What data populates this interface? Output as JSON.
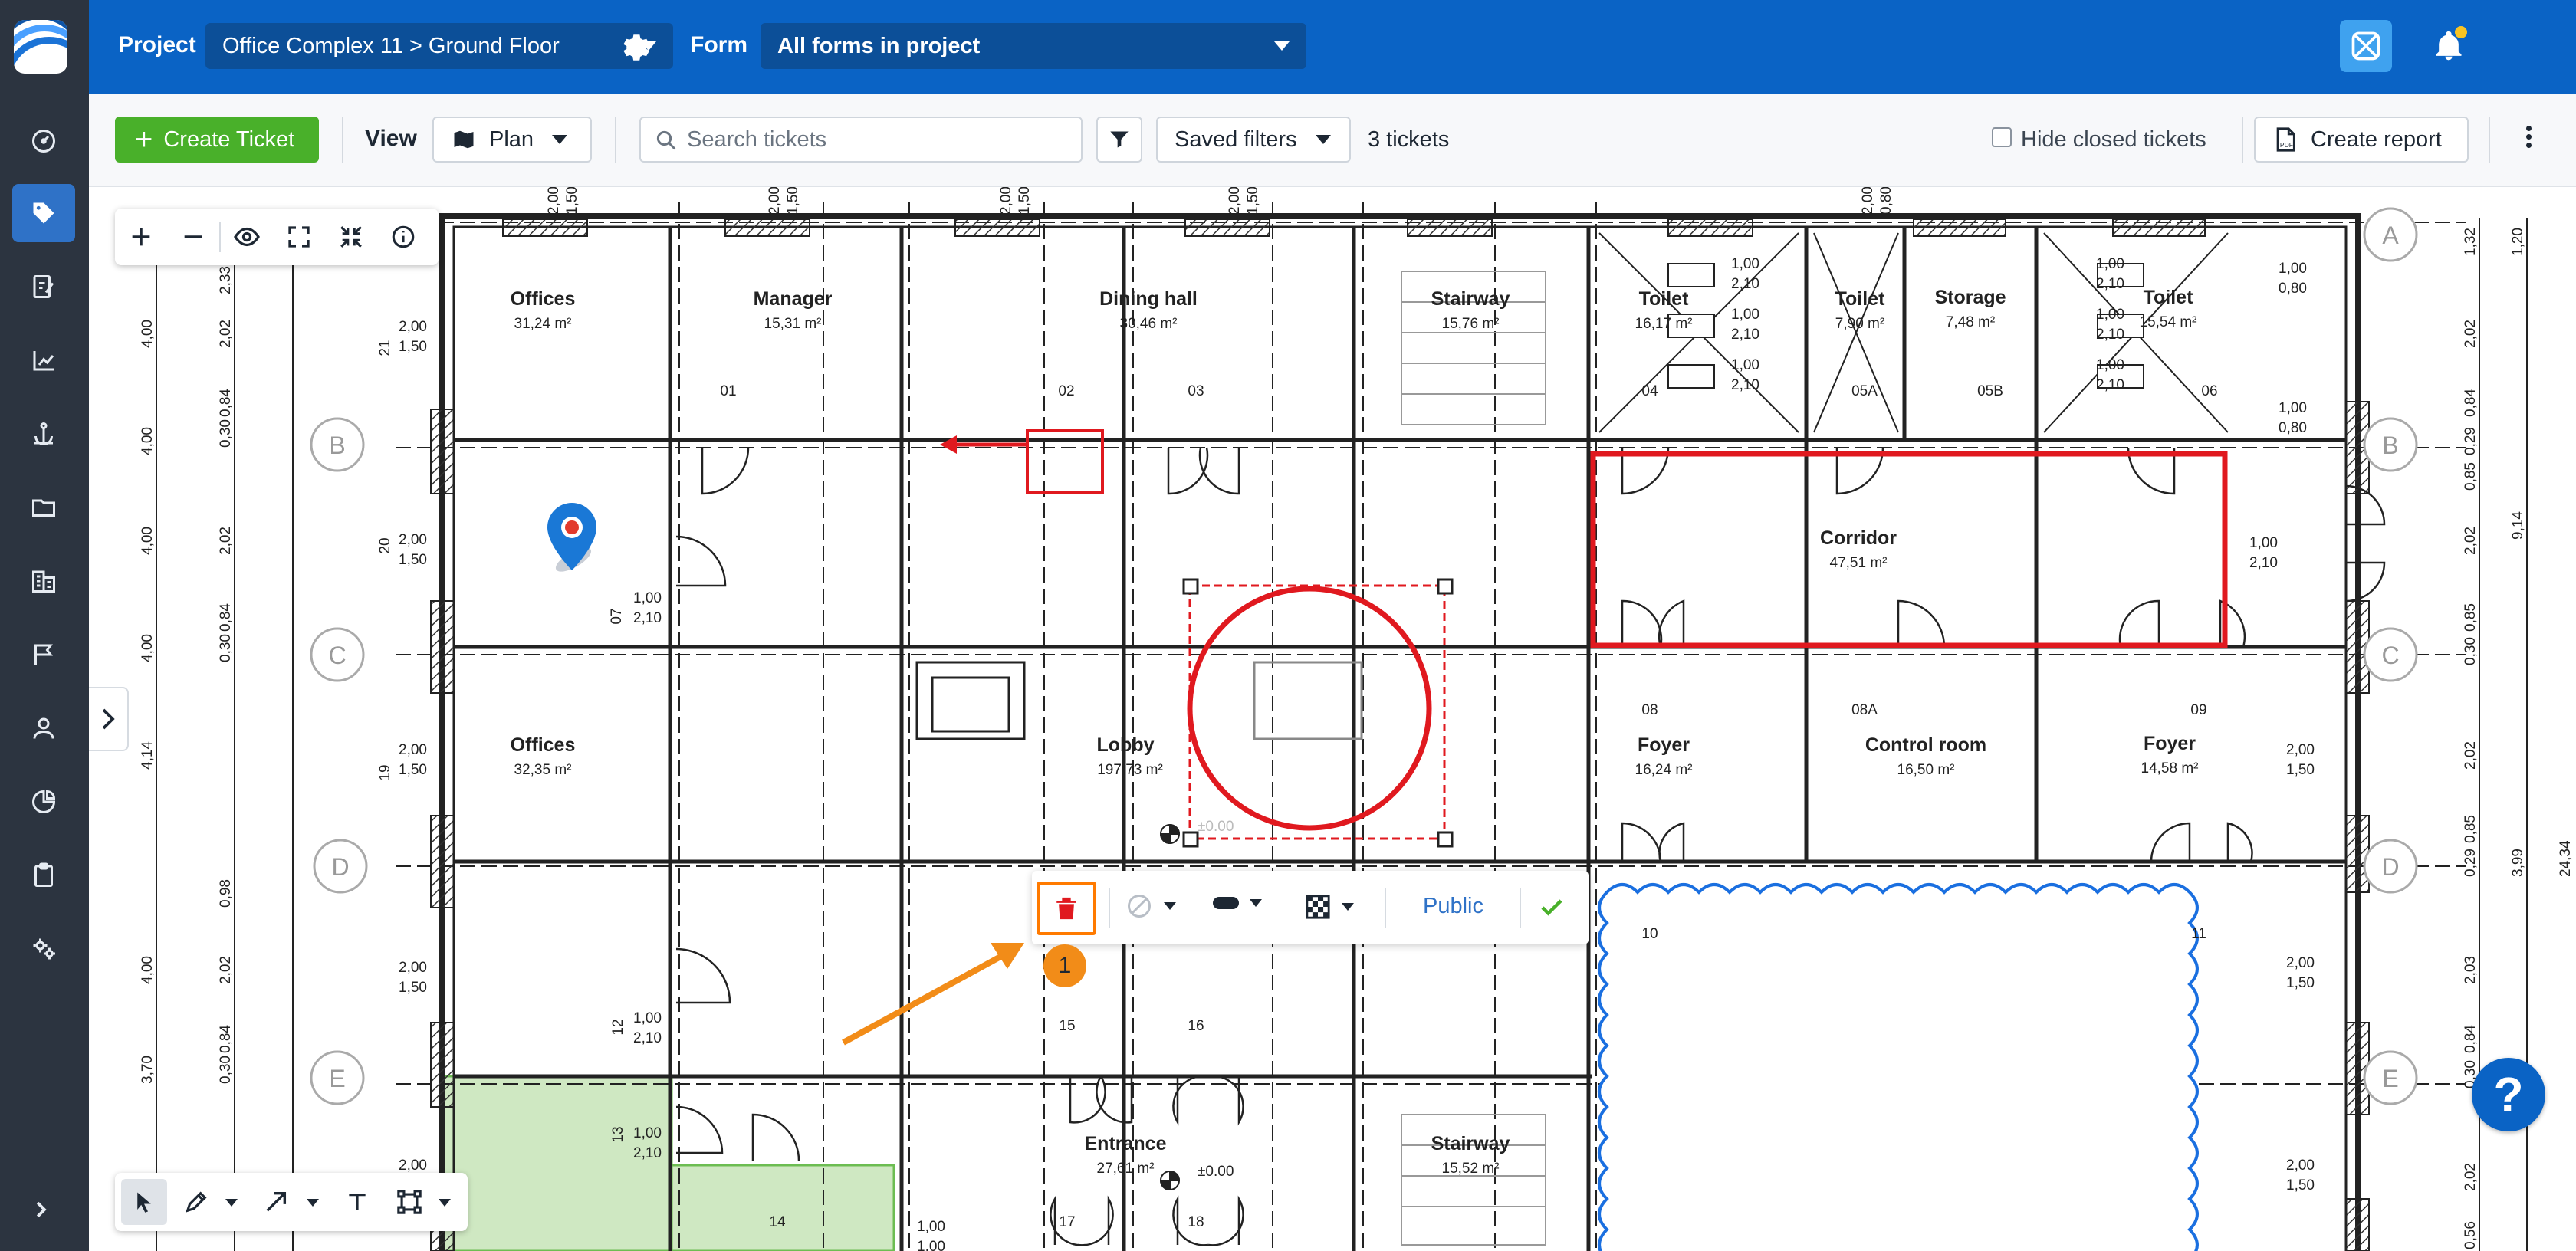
{
  "topbar": {
    "project_label": "Project",
    "project_value": "Office Complex 11 > Ground Floor",
    "form_label": "Form",
    "form_value": "All forms in project"
  },
  "toolbar": {
    "create_ticket": "Create Ticket",
    "view_label": "View",
    "view_value": "Plan",
    "search_placeholder": "Search tickets",
    "saved_filters": "Saved filters",
    "ticket_count": "3 tickets",
    "hide_closed": "Hide closed tickets",
    "create_report": "Create report"
  },
  "rail": {
    "items": [
      "dashboard-icon",
      "tickets-icon",
      "forms-icon",
      "reports-icon",
      "anchor-icon",
      "documents-icon",
      "buildings-icon",
      "flag-icon",
      "user-icon",
      "analytics-icon",
      "clipboard-icon",
      "settings-icon"
    ],
    "active_index": 1
  },
  "markup_bar": {
    "visibility": "Public",
    "step_number": "1"
  },
  "help": {
    "label": "?"
  },
  "colors": {
    "brand_blue": "#0a63c5",
    "create_green": "#49b02a",
    "markup_red": "#e0191f",
    "highlight_orange": "#ff7a00",
    "cloud_blue": "#1a6fe0",
    "area_green": "#cfe8c2"
  },
  "plan": {
    "grid_rows": [
      "A",
      "B",
      "C",
      "D",
      "E"
    ],
    "rooms": [
      {
        "name": "Offices",
        "area": "31,24 m²"
      },
      {
        "name": "Manager",
        "area": "15,31 m²"
      },
      {
        "name": "Dining hall",
        "area": "30,46 m²"
      },
      {
        "name": "Stairway",
        "area": "15,76 m²"
      },
      {
        "name": "Toilet",
        "area": "16,17 m²"
      },
      {
        "name": "Toilet",
        "area": "7,90 m²"
      },
      {
        "name": "Storage",
        "area": "7,48 m²"
      },
      {
        "name": "Toilet",
        "area": "15,54 m²"
      },
      {
        "name": "Corridor",
        "area": "47,51 m²"
      },
      {
        "name": "Offices",
        "area": "32,35 m²"
      },
      {
        "name": "Lobby",
        "area": "197,73 m²"
      },
      {
        "name": "Foyer",
        "area": "16,24 m²"
      },
      {
        "name": "Control room",
        "area": "16,50 m²"
      },
      {
        "name": "Foyer",
        "area": "14,58 m²"
      },
      {
        "name": "Entrance",
        "area": "27,61 m²"
      },
      {
        "name": "Stairway",
        "area": "15,52 m²"
      }
    ],
    "door_numbers": [
      "01",
      "02",
      "03",
      "04",
      "05A",
      "05B",
      "06",
      "07",
      "08",
      "08A",
      "09",
      "10",
      "11",
      "12",
      "13",
      "14",
      "15",
      "16",
      "17",
      "18",
      "19",
      "20",
      "21"
    ],
    "level_marks": [
      "±0.00",
      "±0.00"
    ],
    "dims": {
      "d100": "1,00",
      "d210": "2,10",
      "d200": "2,00",
      "d150": "1,50",
      "d080": "0,80",
      "left_dims": [
        "4,00",
        "4,00",
        "4,00",
        "4,00",
        "4,14",
        "4,00",
        "3,70"
      ],
      "left_dims2": [
        "2,33",
        "2,02",
        "0,84",
        "0,30",
        "2,02",
        "0,84",
        "0,30",
        "0,98",
        "2,02",
        "0,84",
        "0,30"
      ],
      "right_dims": [
        "1,32",
        "2,02",
        "0,84",
        "0,29",
        "0,85",
        "2,02",
        "0,85",
        "0,30",
        "2,02",
        "0,85",
        "0,29",
        "2,03",
        "0,84",
        "0,30",
        "2,02",
        "0,56"
      ],
      "right_dims2": [
        "1,20",
        "9,14",
        "3,99",
        "24,34"
      ],
      "top_dims": [
        "2,00",
        "1,50",
        "0,80"
      ]
    }
  }
}
